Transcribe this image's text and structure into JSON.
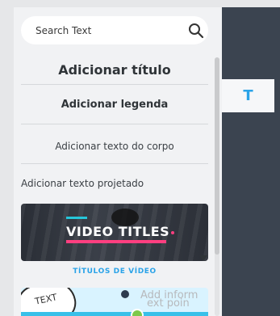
{
  "search": {
    "placeholder": "Search Text"
  },
  "text_options": {
    "title": "Adicionar título",
    "subtitle": "Adicionar legenda",
    "body": "Adicionar texto do corpo",
    "designed": "Adicionar texto projetado"
  },
  "templates": [
    {
      "thumbnail_text": "VIDEO TITLES",
      "label": "TÍTULOS DE VÍDEO"
    },
    {
      "thumbnail_text": "TEXT",
      "info_lines": [
        "Add inform",
        "ext poin"
      ]
    }
  ],
  "right_tab": {
    "icon_text": "T"
  },
  "colors": {
    "accent": "#2aa3e8",
    "dark_panel": "#3b4450",
    "panel_bg": "#f1f2f4",
    "pink": "#ff3f80",
    "cyan": "#26c6da"
  }
}
